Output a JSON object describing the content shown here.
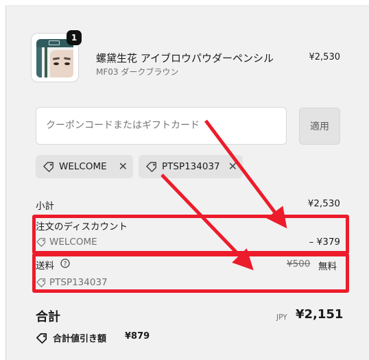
{
  "product": {
    "quantity": "1",
    "name": "螺黛生花 アイブロウパウダーペンシル",
    "variant": "MF03 ダークブラウン",
    "price": "¥2,530"
  },
  "coupon": {
    "placeholder": "クーポンコードまたはギフトカード",
    "apply_label": "適用"
  },
  "applied_codes": [
    {
      "code": "WELCOME"
    },
    {
      "code": "PTSP134037"
    }
  ],
  "summary": {
    "subtotal_label": "小計",
    "subtotal_value": "¥2,530",
    "order_discount_label": "注文のディスカウント",
    "order_discount_code": "WELCOME",
    "order_discount_value": "– ¥379",
    "shipping_label": "送料",
    "shipping_original": "¥500",
    "shipping_value": "無料",
    "shipping_code": "PTSP134037",
    "total_label": "合計",
    "currency": "JPY",
    "total_value": "¥2,151",
    "total_savings_label": "合計値引き額",
    "total_savings_value": "¥879"
  },
  "colors": {
    "annotation_red": "#ec1c2b",
    "panel_bg": "#f1f1f1"
  }
}
